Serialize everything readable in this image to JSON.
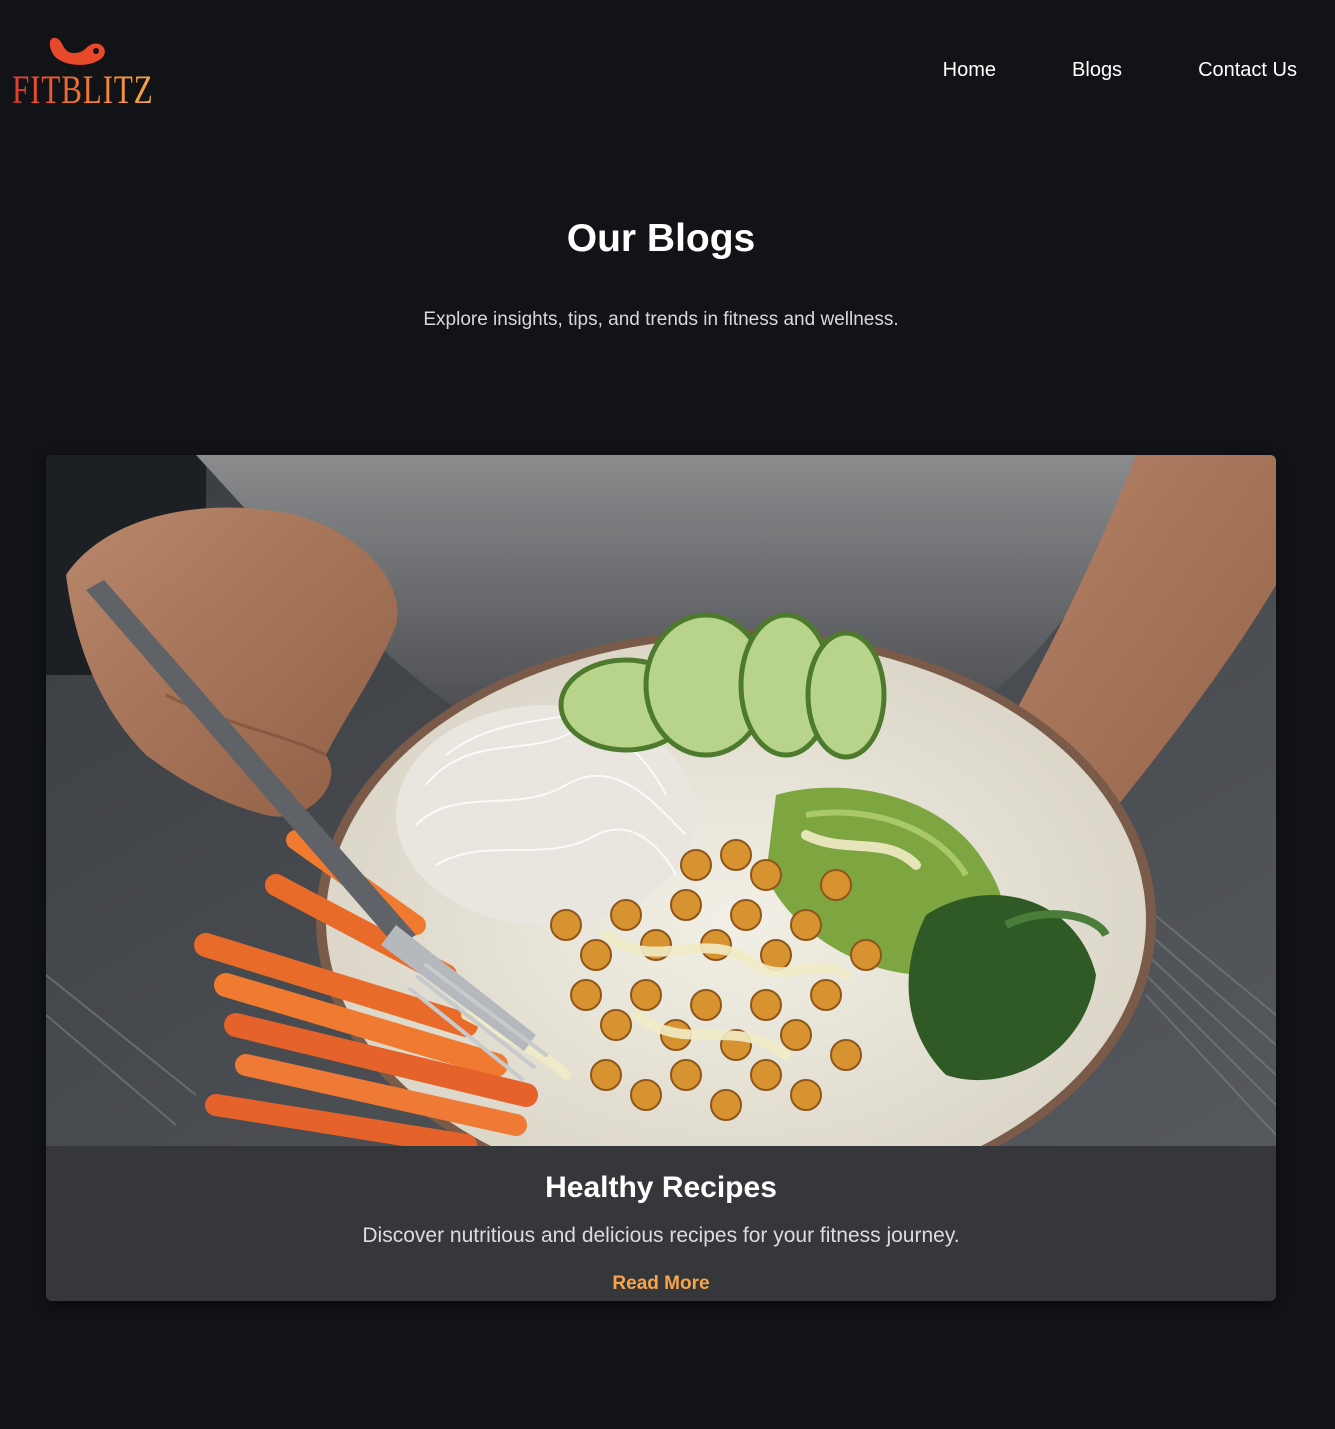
{
  "header": {
    "logo_text": "FITBLITZ",
    "logo_icon": "flexed-arm-icon",
    "nav": [
      {
        "label": "Home"
      },
      {
        "label": "Blogs"
      },
      {
        "label": "Contact Us"
      }
    ]
  },
  "hero": {
    "title": "Our Blogs",
    "subtitle": "Explore insights, tips, and trends in fitness and wellness."
  },
  "blog_cards": [
    {
      "title": "Healthy Recipes",
      "description": "Discover nutritious and delicious recipes for your fitness journey.",
      "link_label": "Read More"
    }
  ],
  "colors": {
    "background": "#121317",
    "card_background": "#36373b",
    "accent": "#f6a54a",
    "logo_red": "#e53b2c",
    "logo_orange": "#f07a30"
  }
}
